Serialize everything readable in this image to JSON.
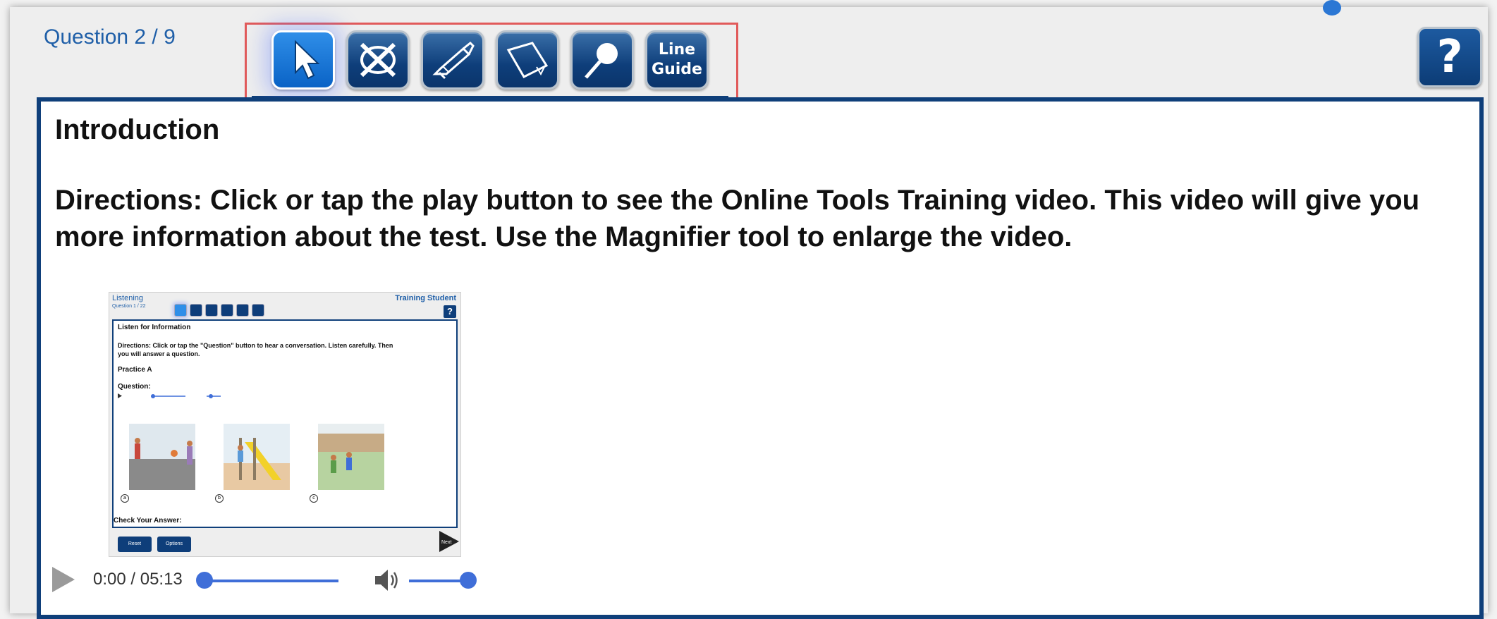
{
  "header": {
    "question_counter": "Question 2 / 9",
    "tools": [
      {
        "name": "pointer",
        "icon": "arrow-pointer-icon",
        "active": true
      },
      {
        "name": "answer-eliminator",
        "icon": "eliminator-icon",
        "active": false
      },
      {
        "name": "highlighter",
        "icon": "highlighter-icon",
        "active": false
      },
      {
        "name": "sticky-note",
        "icon": "sticky-note-icon",
        "active": false
      },
      {
        "name": "magnifier",
        "icon": "magnifier-icon",
        "active": false
      },
      {
        "name": "line-guide",
        "label_line1": "Line",
        "label_line2": "Guide",
        "active": false
      }
    ],
    "help_label": "?"
  },
  "content": {
    "section_title": "Introduction",
    "directions": "Directions: Click or tap the play button to see the Online Tools Training video. This video will give you more information about the test. Use the Magnifier tool to enlarge the video."
  },
  "video": {
    "thumbnail": {
      "title": "Listening",
      "question": "Question 1 / 22",
      "student": "Training Student",
      "heading": "Listen for Information",
      "directions_line1": "Directions: Click or tap the \"Question\" button to hear a conversation. Listen carefully. Then",
      "directions_line2": "you will answer a question.",
      "practice": "Practice A",
      "question_label": "Question:",
      "check": "Check Your Answer:",
      "options": [
        "a",
        "b",
        "c"
      ],
      "btn_reset": "Reset",
      "btn_options": "Options",
      "btn_next": "Next"
    },
    "time": "0:00 / 05:13",
    "progress_fraction": 0.0,
    "volume_fraction": 1.0
  },
  "colors": {
    "accent": "#0f3f7a",
    "active_tool": "#2f8ee8",
    "highlight_box": "#e15a5a",
    "slider": "#3f6ed8",
    "link_text": "#1f5fa8"
  }
}
